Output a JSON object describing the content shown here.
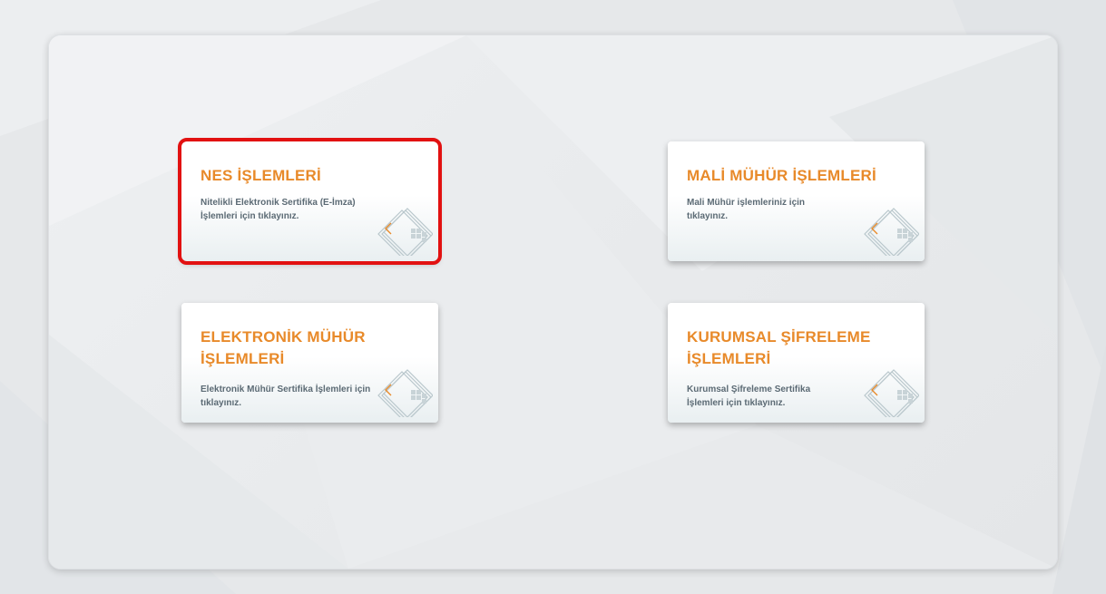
{
  "cards": [
    {
      "title": "NES İŞLEMLERİ",
      "description": "Nitelikli Elektronik Sertifika (E-İmza) İşlemleri için tıklayınız.",
      "selected": true,
      "icon": "smart-card-icon"
    },
    {
      "title": "MALİ MÜHÜR İŞLEMLERİ",
      "description": "Mali Mühür işlemleriniz için tıklayınız.",
      "selected": false,
      "icon": "smart-card-icon"
    },
    {
      "title": "ELEKTRONİK MÜHÜR İŞLEMLERİ",
      "description": "Elektronik Mühür Sertifika İşlemleri için tıklayınız.",
      "selected": false,
      "icon": "smart-card-icon"
    },
    {
      "title": "KURUMSAL ŞİFRELEME İŞLEMLERİ",
      "description": "Kurumsal Şifreleme Sertifika İşlemleri için tıklayınız.",
      "selected": false,
      "icon": "smart-card-icon"
    }
  ],
  "colors": {
    "title": "#e88a2a",
    "description": "#5b6a74",
    "selection_outline": "#e21111"
  }
}
